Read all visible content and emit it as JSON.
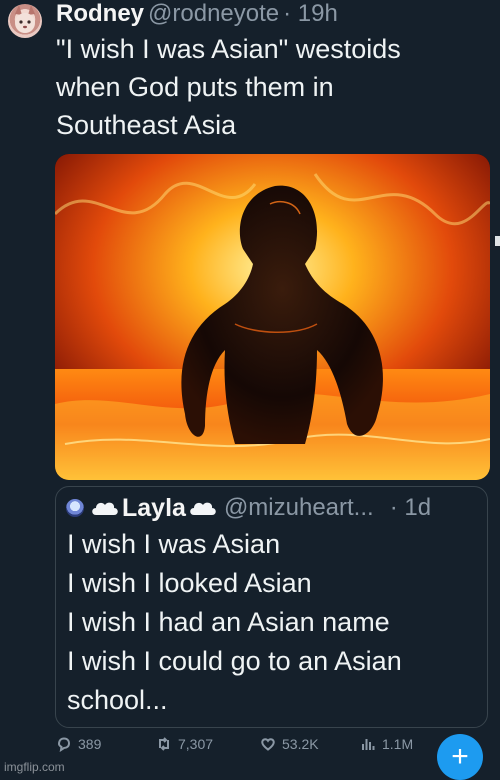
{
  "tweet": {
    "author_name": "Rodney",
    "author_handle": "@rodneyote",
    "time": "· 19h",
    "text": "\"I wish I was Asian\" westoids\nwhen God puts them in\nSoutheast Asia",
    "media_icon": "fiery-figure-image"
  },
  "quote": {
    "name": "Layla",
    "handle": "@mizuheart...",
    "time": "· 1d",
    "text": "I wish I was Asian\nI wish I looked Asian\nI wish I had an Asian name\nI wish I could go to an Asian\nschool..."
  },
  "actions": {
    "replies": "389",
    "retweets": "7,307",
    "likes": "53.2K",
    "views": "1.1M"
  },
  "compose_icon": "+",
  "watermark": "imgflip.com",
  "colors": {
    "background": "#15202b",
    "accent": "#1d9bf0",
    "muted": "#8b98a5"
  }
}
